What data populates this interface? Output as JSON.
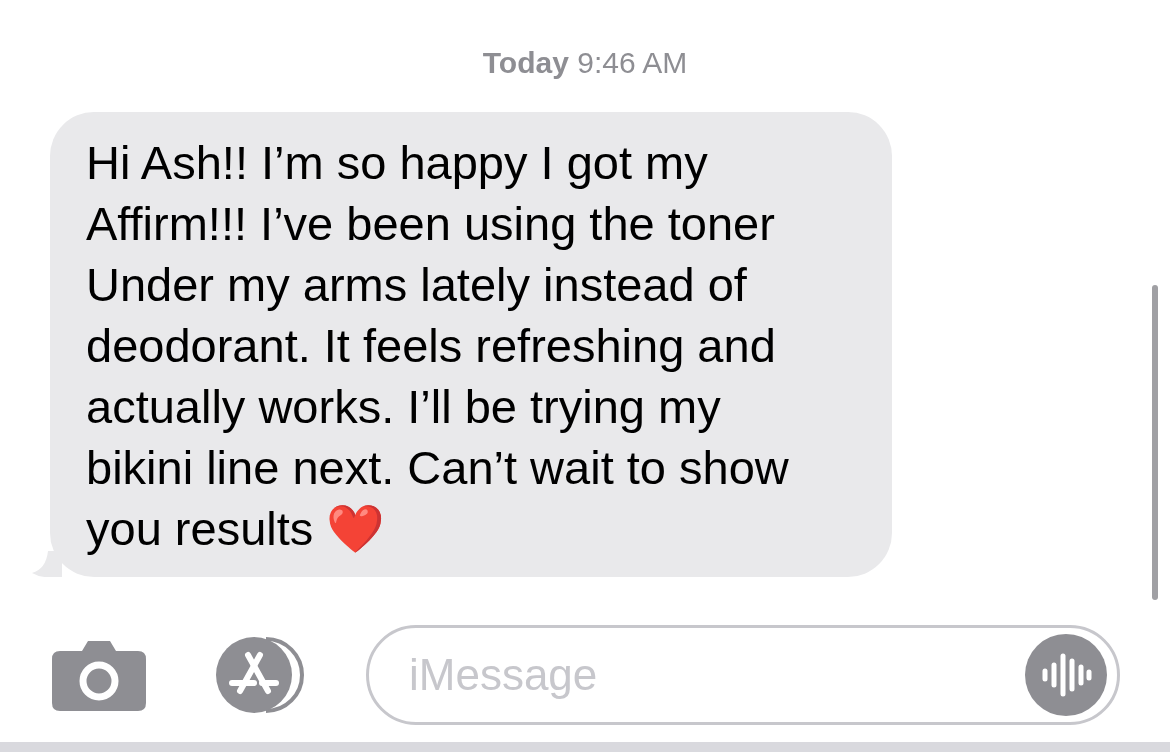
{
  "timestamp": "**Today** 9:46 AM",
  "messages": [
    {
      "kind": "received",
      "text": "Hi Ash!! I’m so happy I got my\nAffirm!!! I’ve been using the toner\nUnder my arms lately instead of\ndeodorant. It feels refreshing and\nactually works. I’ll be trying my\nbikini line next. Can’t wait to show\nyou results ❤️"
    }
  ],
  "composer": {
    "placeholder": "iMessage"
  }
}
